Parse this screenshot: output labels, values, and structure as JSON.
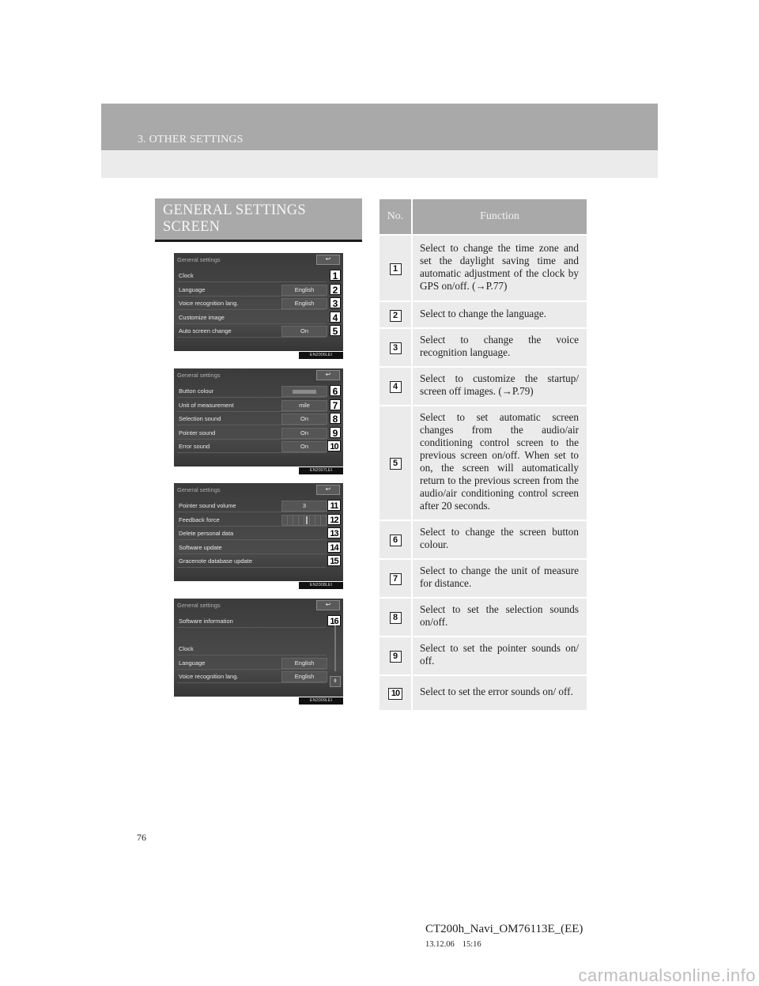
{
  "header": {
    "section_title": "3. OTHER SETTINGS"
  },
  "left": {
    "heading": "GENERAL SETTINGS SCREEN",
    "screens": [
      {
        "title": "General settings",
        "back_icon": "↩",
        "image_code": "EN2006LEI",
        "rows": [
          {
            "label": "Clock",
            "value": null,
            "num": "1"
          },
          {
            "label": "Language",
            "value": "English",
            "num": "2"
          },
          {
            "label": "Voice recognition lang.",
            "value": "English",
            "num": "3"
          },
          {
            "label": "Customize image",
            "value": null,
            "num": "4"
          },
          {
            "label": "Auto screen change",
            "value": "On",
            "num": "5"
          }
        ]
      },
      {
        "title": "General settings",
        "back_icon": "↩",
        "image_code": "EN2007LEI",
        "rows": [
          {
            "label": "Button colour",
            "value": "",
            "num": "6"
          },
          {
            "label": "Unit of measurement",
            "value": "mile",
            "num": "7"
          },
          {
            "label": "Selection sound",
            "value": "On",
            "num": "8"
          },
          {
            "label": "Pointer sound",
            "value": "On",
            "num": "9"
          },
          {
            "label": "Error sound",
            "value": "On",
            "num": "10"
          }
        ]
      },
      {
        "title": "General settings",
        "back_icon": "↩",
        "image_code": "EN2008LEI",
        "rows": [
          {
            "label": "Pointer sound volume",
            "value": "3",
            "num": "11"
          },
          {
            "label": "Feedback force",
            "value": "",
            "num": "12"
          },
          {
            "label": "Delete personal data",
            "value": null,
            "num": "13"
          },
          {
            "label": "Software update",
            "value": null,
            "num": "14"
          },
          {
            "label": "Gracenote database update",
            "value": null,
            "num": "15"
          }
        ]
      },
      {
        "title": "General settings",
        "back_icon": "↩",
        "image_code": "EN2009LEI",
        "rows": [
          {
            "label": "Software information",
            "value": null,
            "num": "16"
          },
          {
            "label": "",
            "value": null,
            "num": null
          },
          {
            "label": "Clock",
            "value": null,
            "num": null
          },
          {
            "label": "Language",
            "value": "English",
            "num": null
          },
          {
            "label": "Voice recognition lang.",
            "value": "English",
            "num": null
          }
        ],
        "scroll_down_icon": "⇟"
      }
    ]
  },
  "table": {
    "headers": {
      "no": "No.",
      "function": "Function"
    },
    "rows": [
      {
        "no": "1",
        "text": "Select to change the time zone and set the daylight saving time and automatic adjustment of the clock by GPS on/off. (→P.77)"
      },
      {
        "no": "2",
        "text": "Select to change the language."
      },
      {
        "no": "3",
        "text": "Select to change the voice recognition language."
      },
      {
        "no": "4",
        "text": "Select to customize the startup/ screen off images. (→P.79)"
      },
      {
        "no": "5",
        "text": "Select to set automatic screen changes from the audio/air conditioning control screen to the previous screen on/off. When set to on, the screen will automatically return to the previous screen from the audio/air conditioning control screen after 20 seconds."
      },
      {
        "no": "6",
        "text": "Select to change the screen button colour."
      },
      {
        "no": "7",
        "text": "Select to change the unit of measure for distance."
      },
      {
        "no": "8",
        "text": "Select to set the selection sounds on/off."
      },
      {
        "no": "9",
        "text": "Select to set the pointer sounds on/ off."
      },
      {
        "no": "10",
        "text": "Select to set the error sounds on/ off."
      }
    ]
  },
  "footer": {
    "page_number": "76",
    "doc_id": "CT200h_Navi_OM76113E_(EE)",
    "date": "13.12.06",
    "time": "15:16",
    "watermark": "carmanualsonline.info"
  }
}
